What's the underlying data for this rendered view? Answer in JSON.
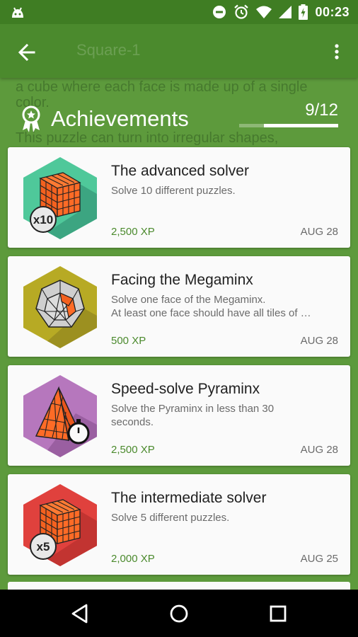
{
  "status_bar": {
    "time": "00:23",
    "icons": [
      "android-icon",
      "do-not-disturb-icon",
      "alarm-icon",
      "wifi-icon",
      "signal-icon",
      "battery-charging-icon"
    ]
  },
  "toolbar": {
    "back_icon": "arrow-left-icon",
    "menu_icon": "more-vert-icon",
    "underlying_title": "Square-1"
  },
  "underlying_text": [
    "a cube where each face is made up of a single",
    "color.",
    "This puzzle can turn into irregular shapes,"
  ],
  "header": {
    "icon": "award-icon",
    "title": "Achievements",
    "progress_text": "9/12",
    "progress_fraction": 0.75
  },
  "achievements": [
    {
      "name": "The advanced solver",
      "description": [
        "Solve 10 different puzzles."
      ],
      "xp": "2,500 XP",
      "date": "AUG 28",
      "badge_color": "#4fc89a",
      "badge_label": "x10",
      "badge_icon": "cube-icon"
    },
    {
      "name": "Facing the Megaminx",
      "description": [
        "Solve one face of the Megaminx.",
        "At least one face should have all tiles of …"
      ],
      "xp": "500 XP",
      "date": "AUG 28",
      "badge_color": "#b7aa24",
      "badge_icon": "megaminx-icon"
    },
    {
      "name": "Speed-solve Pyraminx",
      "description": [
        "Solve the Pyraminx in less than 30",
        "seconds."
      ],
      "xp": "2,500 XP",
      "date": "AUG 28",
      "badge_color": "#b677bd",
      "badge_icon": "pyraminx-icon"
    },
    {
      "name": "The intermediate solver",
      "description": [
        "Solve 5 different puzzles."
      ],
      "xp": "2,000 XP",
      "date": "AUG 25",
      "badge_color": "#e0413d",
      "badge_label": "x5",
      "badge_icon": "cube-icon"
    }
  ],
  "nav_bar": {
    "back_icon": "nav-back-icon",
    "home_icon": "nav-home-icon",
    "recents_icon": "nav-recents-icon"
  }
}
